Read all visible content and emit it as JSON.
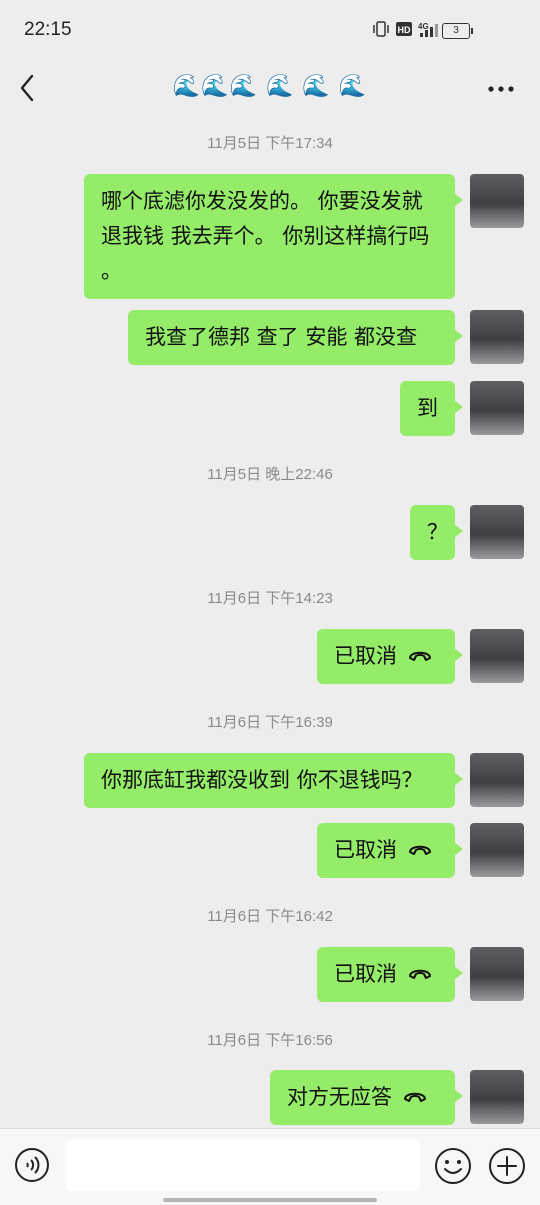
{
  "status_bar": {
    "time": "22:15",
    "network": "4G",
    "battery": "3"
  },
  "header": {
    "title": "🌊🌊🌊 🌊 🌊 🌊"
  },
  "messages": [
    {
      "type": "time",
      "text": "11月5日 下午17:34"
    },
    {
      "type": "text",
      "text": "哪个底滤你发没发的。 你要没发就退我钱 我去弄个。 你别这样搞行吗 。"
    },
    {
      "type": "text",
      "text": "我查了德邦 查了 安能 都没查"
    },
    {
      "type": "text",
      "text": "到"
    },
    {
      "type": "time",
      "text": "11月5日 晚上22:46"
    },
    {
      "type": "text",
      "text": "？"
    },
    {
      "type": "time",
      "text": "11月6日 下午14:23"
    },
    {
      "type": "call",
      "text": "已取消"
    },
    {
      "type": "time",
      "text": "11月6日 下午16:39"
    },
    {
      "type": "text",
      "text": "你那底缸我都没收到 你不退钱吗？"
    },
    {
      "type": "call",
      "text": "已取消"
    },
    {
      "type": "time",
      "text": "11月6日 下午16:42"
    },
    {
      "type": "call",
      "text": "已取消"
    },
    {
      "type": "time",
      "text": "11月6日 下午16:56"
    },
    {
      "type": "call",
      "text": "对方无应答"
    }
  ],
  "colors": {
    "bubble": "#95ec69",
    "background": "#ededed",
    "time_text": "#8a8a8a"
  },
  "icons": {
    "back": "chevron-left-icon",
    "more": "more-dots-icon",
    "call": "phone-hangup-icon",
    "voice": "voice-icon",
    "emoji": "emoji-icon",
    "plus": "plus-icon"
  }
}
